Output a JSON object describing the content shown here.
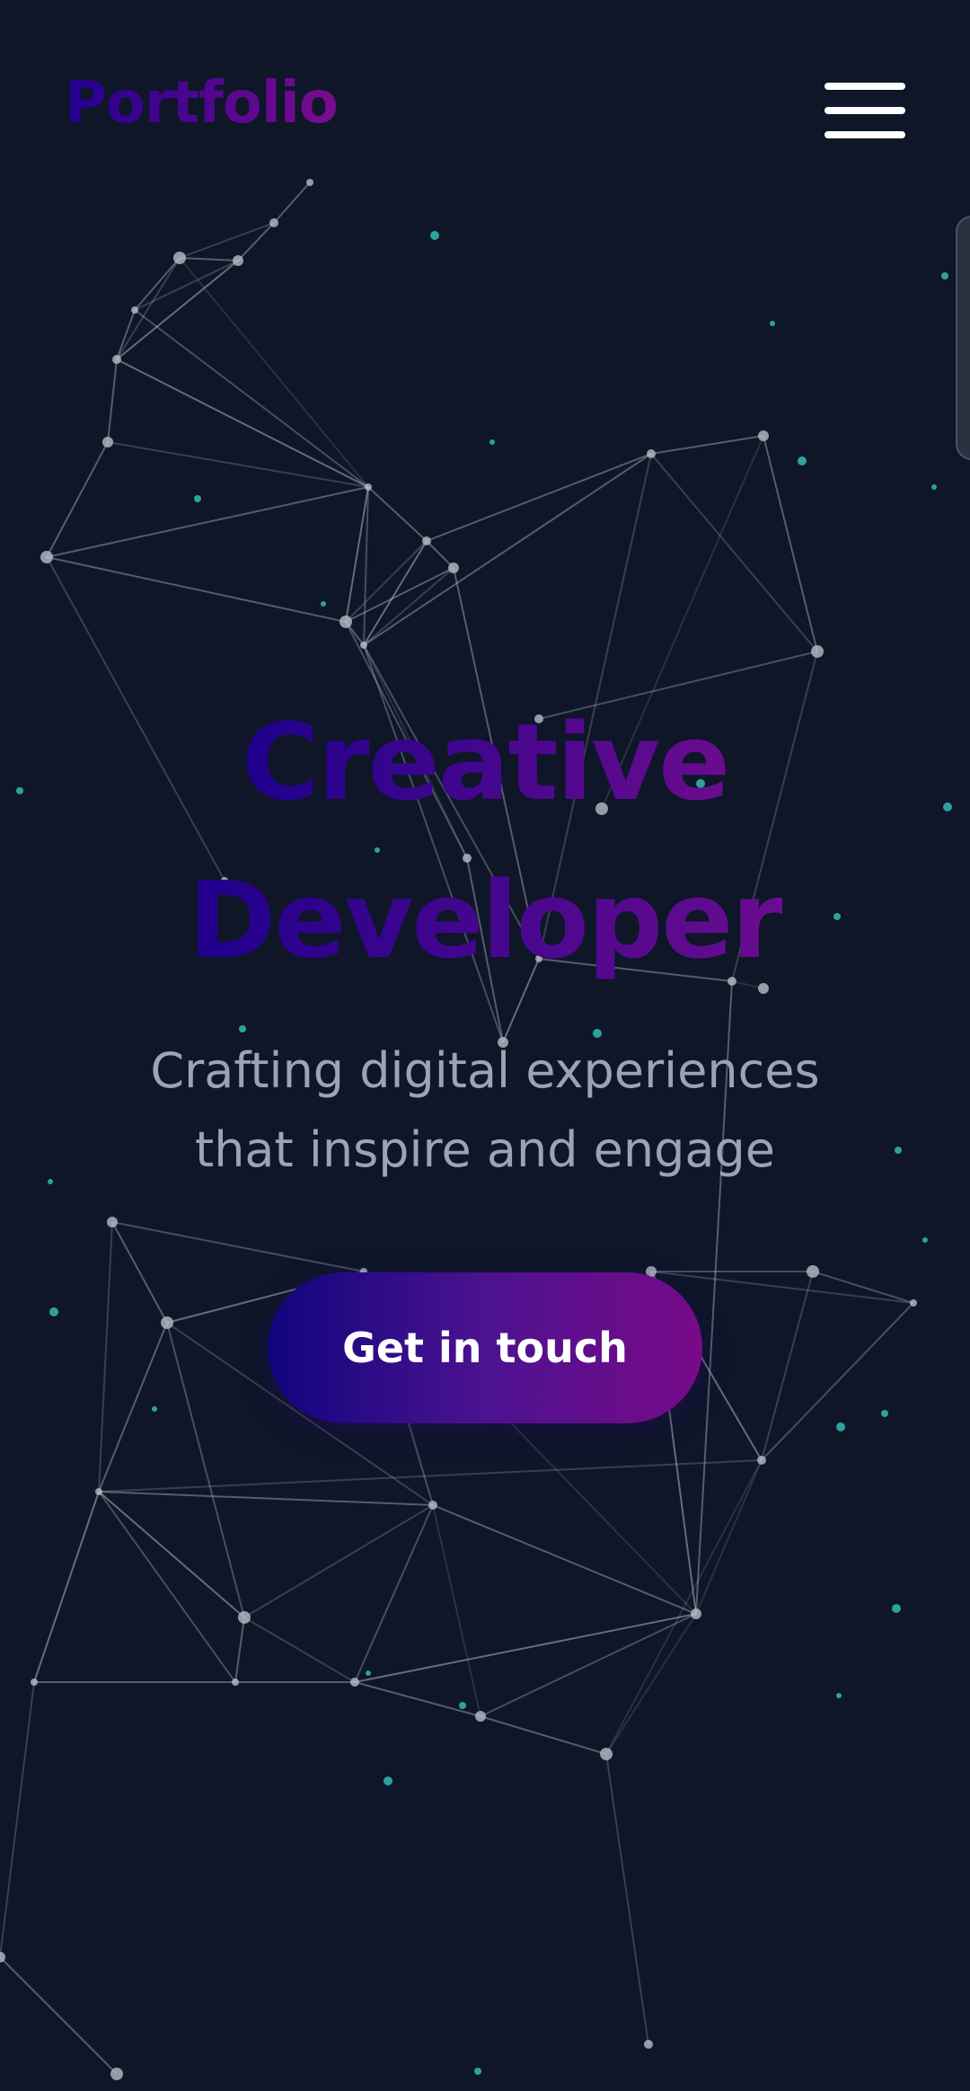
{
  "header": {
    "logo_text": "Portfolio",
    "menu_icon": "hamburger-menu-icon"
  },
  "hero": {
    "title_line1": "Creative",
    "title_line2": "Developer",
    "subtitle_line1": "Crafting digital experiences",
    "subtitle_line2": "that inspire and engage",
    "cta_label": "Get in touch"
  },
  "colors": {
    "background": "#0e1628",
    "gradient_start": "#1f008c",
    "gradient_end": "#7a0c8f",
    "subtitle": "#9ba3b4",
    "network_line": "#c9ccd6",
    "particle": "#39d0c6"
  }
}
